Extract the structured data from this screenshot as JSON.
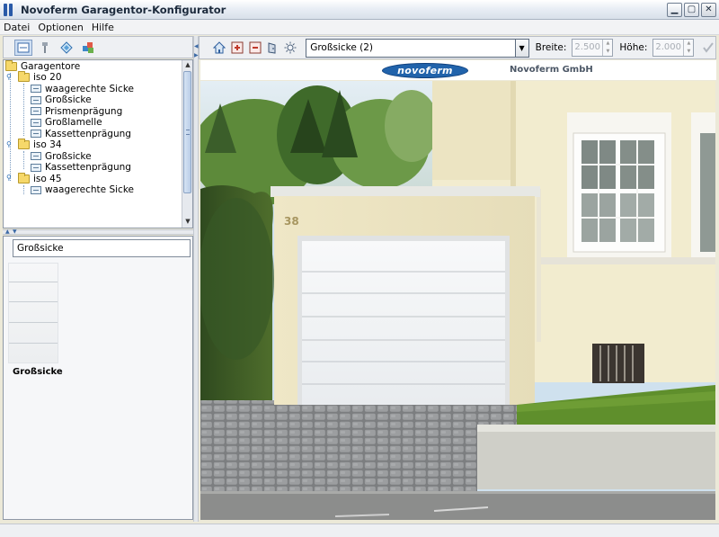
{
  "window": {
    "title": "Novoferm Garagentor-Konfigurator"
  },
  "menu": [
    "Datei",
    "Optionen",
    "Hilfe"
  ],
  "left_toolbar": {
    "icons": [
      "tor-view-icon",
      "tool-icon",
      "diamond-icon",
      "puzzle-icon"
    ]
  },
  "tree": {
    "root": "Garagentore",
    "items": [
      {
        "type": "folder",
        "label": "iso 20",
        "level": 1
      },
      {
        "type": "leaf",
        "label": "waagerechte Sicke",
        "level": 2
      },
      {
        "type": "leaf",
        "label": "Großsicke",
        "level": 2
      },
      {
        "type": "leaf",
        "label": "Prismenprägung",
        "level": 2
      },
      {
        "type": "leaf",
        "label": "Großlamelle",
        "level": 2
      },
      {
        "type": "leaf",
        "label": "Kassettenprägung",
        "level": 2
      },
      {
        "type": "folder",
        "label": "iso 34",
        "level": 1
      },
      {
        "type": "leaf",
        "label": "Großsicke",
        "level": 2
      },
      {
        "type": "leaf",
        "label": "Kassettenprägung",
        "level": 2
      },
      {
        "type": "folder",
        "label": "iso 45",
        "level": 1
      },
      {
        "type": "leaf",
        "label": "waagerechte Sicke",
        "level": 2
      }
    ]
  },
  "detail": {
    "name_field": "Großsicke",
    "preview_label": "Großsicke"
  },
  "right_toolbar": {
    "icons": [
      "home-icon",
      "add-image-icon",
      "remove-image-icon",
      "door-icon",
      "sun-icon"
    ],
    "combo_value": "Großsicke (2)",
    "width_label": "Breite:",
    "width_value": "2.500",
    "height_label": "Höhe:",
    "height_value": "2.000"
  },
  "brand": {
    "logo_text": "novoferm",
    "company": "Novoferm GmbH"
  },
  "scene": {
    "house_number": "38"
  },
  "colors": {
    "brand_blue": "#2163ab",
    "accent": "#2a5aa8"
  }
}
